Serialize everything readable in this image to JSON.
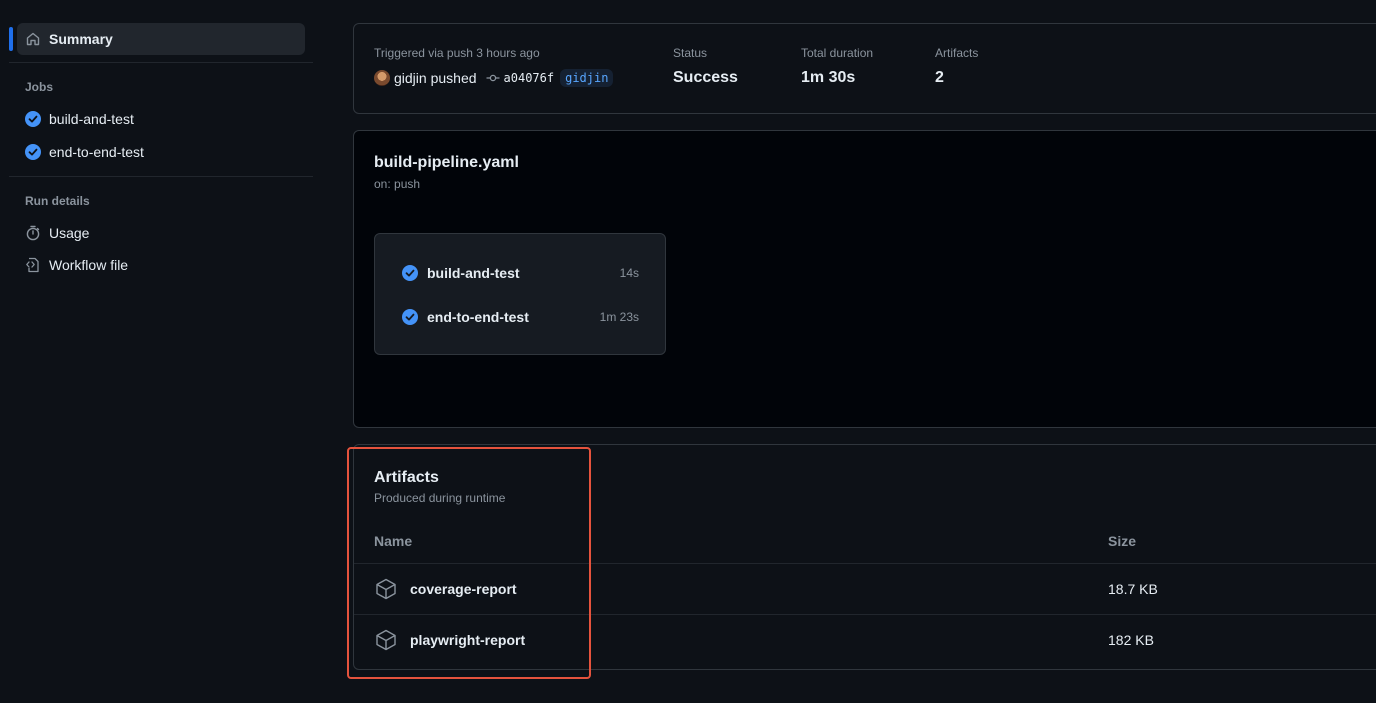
{
  "sidebar": {
    "summary_label": "Summary",
    "jobs_heading": "Jobs",
    "jobs": [
      {
        "label": "build-and-test"
      },
      {
        "label": "end-to-end-test"
      }
    ],
    "run_details_heading": "Run details",
    "run_details": [
      {
        "label": "Usage",
        "icon": "stopwatch-icon"
      },
      {
        "label": "Workflow file",
        "icon": "file-code-icon"
      }
    ]
  },
  "summary": {
    "trigger_label": "Triggered via push 3 hours ago",
    "actor": "gidjin",
    "action": "pushed",
    "commit_sha": "a04076f",
    "branch": "gidjin",
    "status_label": "Status",
    "status_value": "Success",
    "duration_label": "Total duration",
    "duration_value": "1m 30s",
    "artifacts_label": "Artifacts",
    "artifacts_value": "2"
  },
  "workflow": {
    "file": "build-pipeline.yaml",
    "trigger": "on: push",
    "jobs": [
      {
        "name": "build-and-test",
        "duration": "14s"
      },
      {
        "name": "end-to-end-test",
        "duration": "1m 23s"
      }
    ]
  },
  "artifacts": {
    "title": "Artifacts",
    "subtitle": "Produced during runtime",
    "col_name": "Name",
    "col_size": "Size",
    "items": [
      {
        "name": "coverage-report",
        "size": "18.7 KB"
      },
      {
        "name": "playwright-report",
        "size": "182 KB"
      }
    ]
  },
  "colors": {
    "accent": "#1f6feb",
    "success_check": "#4493f8",
    "highlight": "#e5533d"
  }
}
